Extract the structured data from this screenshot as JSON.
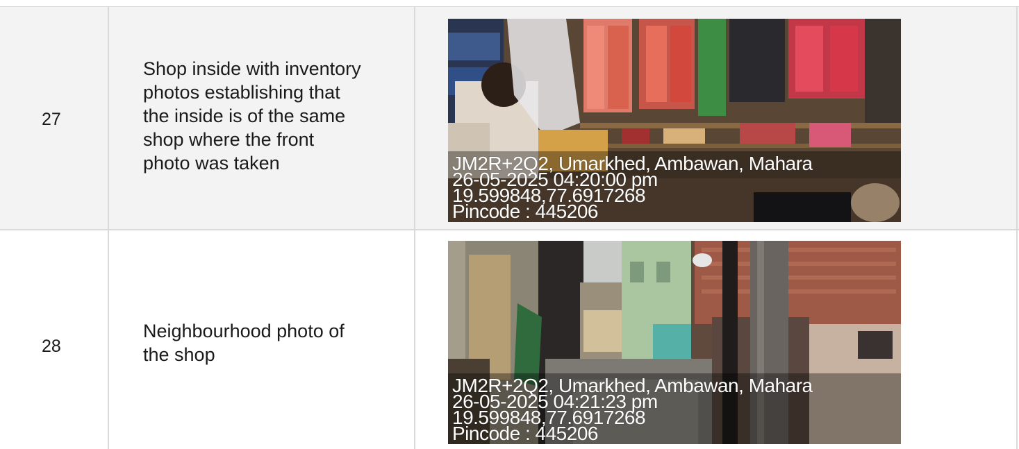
{
  "rows": [
    {
      "number": "27",
      "description_lines": [
        "Shop inside with inventory",
        "photos establishing that",
        "the inside is of the same",
        "shop where the front",
        "photo was taken"
      ],
      "photo": {
        "subject": "shop-interior",
        "stamp": {
          "location": "JM2R+2Q2, Umarkhed, Ambawan, Mahara",
          "datetime": "26-05-2025 04:20:00 pm",
          "coordinates": "19.599848,77.6917268",
          "pincode": "Pincode : 445206"
        }
      }
    },
    {
      "number": "28",
      "description_lines": [
        "Neighbourhood photo of",
        "the shop"
      ],
      "photo": {
        "subject": "street-neighbourhood",
        "stamp": {
          "location": "JM2R+2Q2, Umarkhed, Ambawan, Mahara",
          "datetime": "26-05-2025 04:21:23 pm",
          "coordinates": "19.599848,77.6917268",
          "pincode": "Pincode : 445206"
        }
      }
    }
  ]
}
